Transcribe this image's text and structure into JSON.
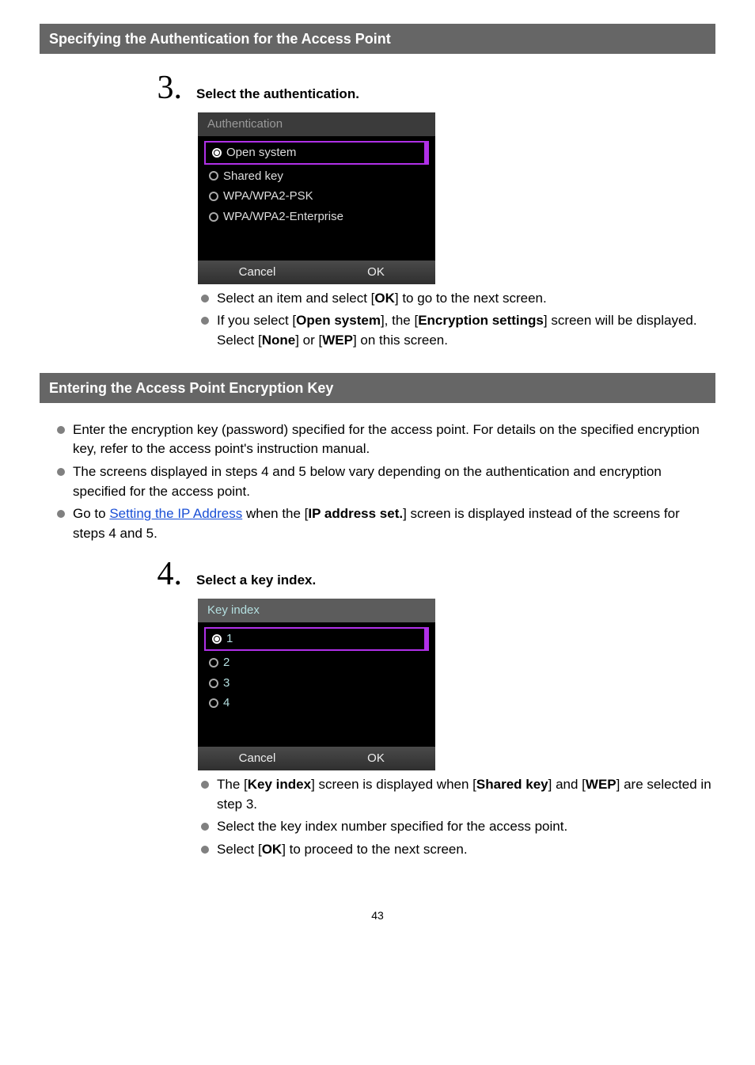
{
  "section1": {
    "title": "Specifying the Authentication for the Access Point"
  },
  "step3": {
    "num": "3.",
    "title": "Select the authentication."
  },
  "authShot": {
    "heading": "Authentication",
    "opt0": "Open system",
    "opt1": "Shared key",
    "opt2": "WPA/WPA2-PSK",
    "opt3": "WPA/WPA2-Enterprise",
    "cancel": "Cancel",
    "ok": "OK"
  },
  "step3_notes": {
    "n1a": "Select an item and select [",
    "n1b": "OK",
    "n1c": "] to go to the next screen.",
    "n2a": "If you select [",
    "n2b": "Open system",
    "n2c": "], the [",
    "n2d": "Encryption settings",
    "n2e": "] screen will be displayed. Select [",
    "n2f": "None",
    "n2g": "] or [",
    "n2h": "WEP",
    "n2i": "] on this screen."
  },
  "section2": {
    "title": "Entering the Access Point Encryption Key"
  },
  "body_bullets": {
    "b1": "Enter the encryption key (password) specified for the access point. For details on the specified encryption key, refer to the access point's instruction manual.",
    "b2": "The screens displayed in steps 4 and 5 below vary depending on the authentication and encryption specified for the access point.",
    "b3a": "Go to ",
    "b3link": "Setting the IP Address",
    "b3b": " when the [",
    "b3c": "IP address set.",
    "b3d": "] screen is displayed instead of the screens for steps 4 and 5."
  },
  "step4": {
    "num": "4.",
    "title": "Select a key index."
  },
  "keyShot": {
    "heading": "Key index",
    "opt0": "1",
    "opt1": "2",
    "opt2": "3",
    "opt3": "4",
    "cancel": "Cancel",
    "ok": "OK"
  },
  "step4_notes": {
    "n1a": "The [",
    "n1b": "Key index",
    "n1c": "] screen is displayed when [",
    "n1d": "Shared key",
    "n1e": "] and [",
    "n1f": "WEP",
    "n1g": "] are selected in step 3.",
    "n2": "Select the key index number specified for the access point.",
    "n3a": "Select [",
    "n3b": "OK",
    "n3c": "] to proceed to the next screen."
  },
  "page": {
    "num": "43"
  }
}
